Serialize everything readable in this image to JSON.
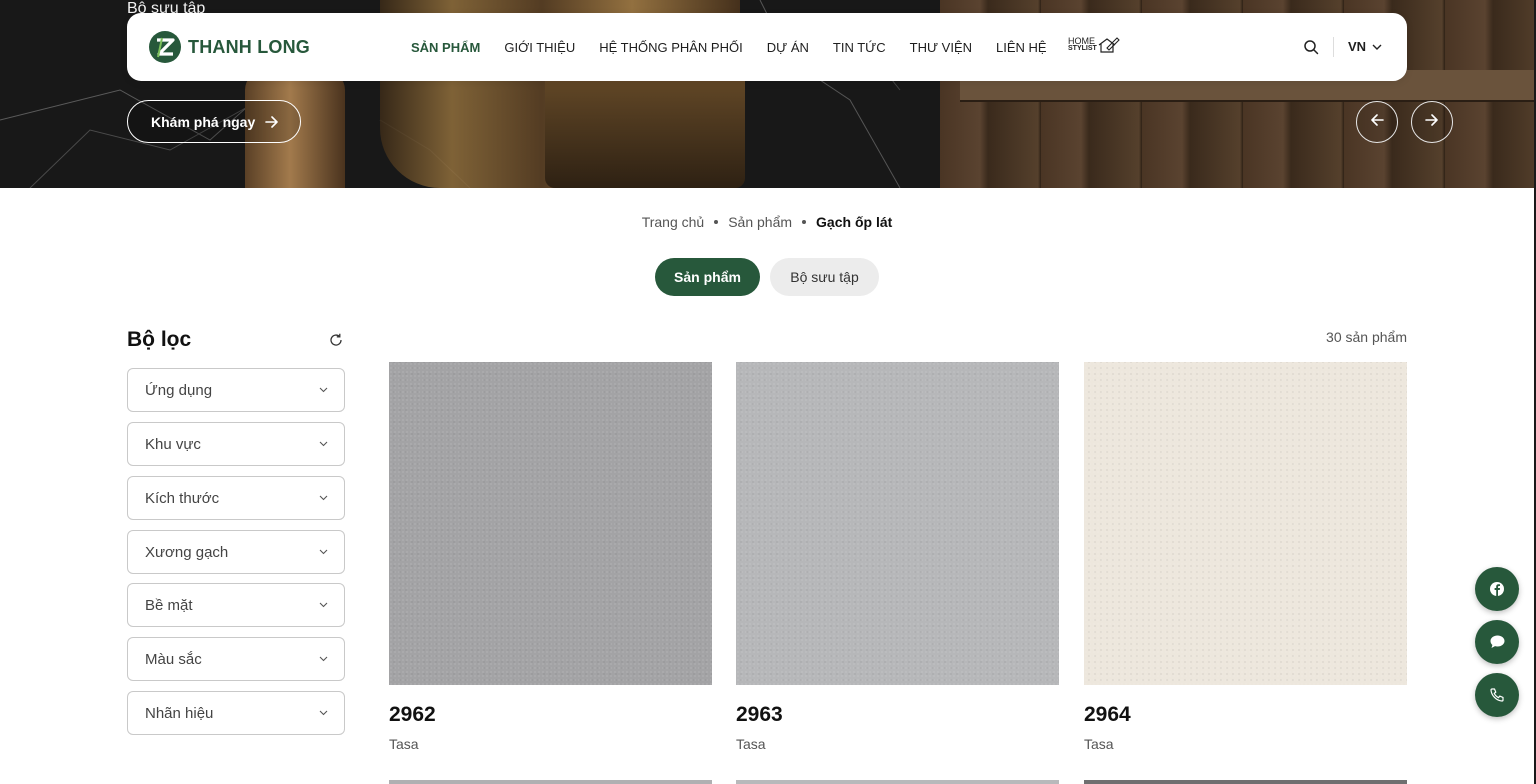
{
  "colors": {
    "brand": "#27583b",
    "tab_inactive": "#ececec",
    "border": "#c9c9c9"
  },
  "hero": {
    "caption": "Bộ sưu tập",
    "cta_label": "Khám phá ngay",
    "prev_icon": "arrow-left-icon",
    "next_icon": "arrow-right-icon"
  },
  "header": {
    "logo_text": "THANH LONG",
    "nav": [
      {
        "label": "SẢN PHẨM",
        "active": true
      },
      {
        "label": "GIỚI THIỆU"
      },
      {
        "label": "HỆ THỐNG PHÂN PHỐI"
      },
      {
        "label": "DỰ ÁN"
      },
      {
        "label": "TIN TỨC"
      },
      {
        "label": "THƯ VIỆN"
      },
      {
        "label": "LIÊN HỆ"
      }
    ],
    "home_stylist_top": "HOME",
    "home_stylist_bottom": "STYLIST",
    "language": "VN"
  },
  "breadcrumb": [
    "Trang chủ",
    "Sản phẩm",
    "Gạch ốp lát"
  ],
  "tabs": [
    "Sản phẩm",
    "Bộ sưu tập"
  ],
  "filter": {
    "title": "Bộ lọc",
    "options": [
      "Ứng dụng",
      "Khu vực",
      "Kích thước",
      "Xương gạch",
      "Bề mặt",
      "Màu sắc",
      "Nhãn hiệu"
    ]
  },
  "products": {
    "count_label": "30 sản phẩm",
    "items": [
      {
        "name": "2962",
        "brand": "Tasa",
        "tile_color": "#a3a3a5"
      },
      {
        "name": "2963",
        "brand": "Tasa",
        "tile_color": "#b6b7b9"
      },
      {
        "name": "2964",
        "brand": "Tasa",
        "tile_color": "#ede7dd"
      }
    ]
  },
  "float_buttons": [
    "facebook-icon",
    "chat-icon",
    "phone-icon"
  ]
}
